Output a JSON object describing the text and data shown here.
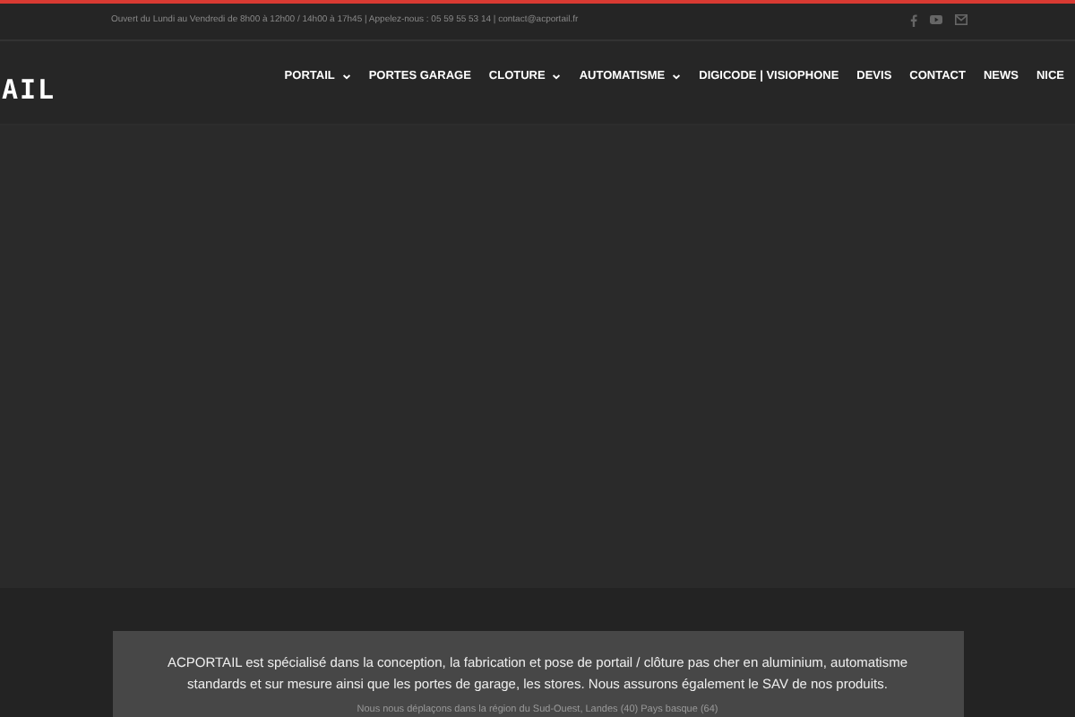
{
  "top_bar": {
    "info": "Ouvert du Lundi au Vendredi de 8h00 à 12h00 / 14h00 à 17h45 | Appelez-nous : 05 59 55 53 14  |  contact@acportail.fr"
  },
  "logo": {
    "text": "AIL"
  },
  "nav": [
    {
      "label": "PORTAIL",
      "dropdown": true
    },
    {
      "label": "PORTES GARAGE",
      "dropdown": false
    },
    {
      "label": "CLOTURE",
      "dropdown": true
    },
    {
      "label": "AUTOMATISME",
      "dropdown": true
    },
    {
      "label": "DIGICODE | VISIOPHONE",
      "dropdown": false
    },
    {
      "label": "DEVIS",
      "dropdown": false
    },
    {
      "label": "CONTACT",
      "dropdown": false
    },
    {
      "label": "NEWS",
      "dropdown": false
    },
    {
      "label": "NICE",
      "dropdown": false
    }
  ],
  "intro": {
    "text": "ACPORTAIL est spécialisé dans la conception, la fabrication et pose de portail / clôture pas cher en aluminium, automatisme standards et sur mesure ainsi que les portes de garage, les stores. Nous assurons également le SAV de nos produits.",
    "note": "Nous nous déplaçons dans la région du Sud-Ouest, Landes (40) Pays basque (64)"
  }
}
